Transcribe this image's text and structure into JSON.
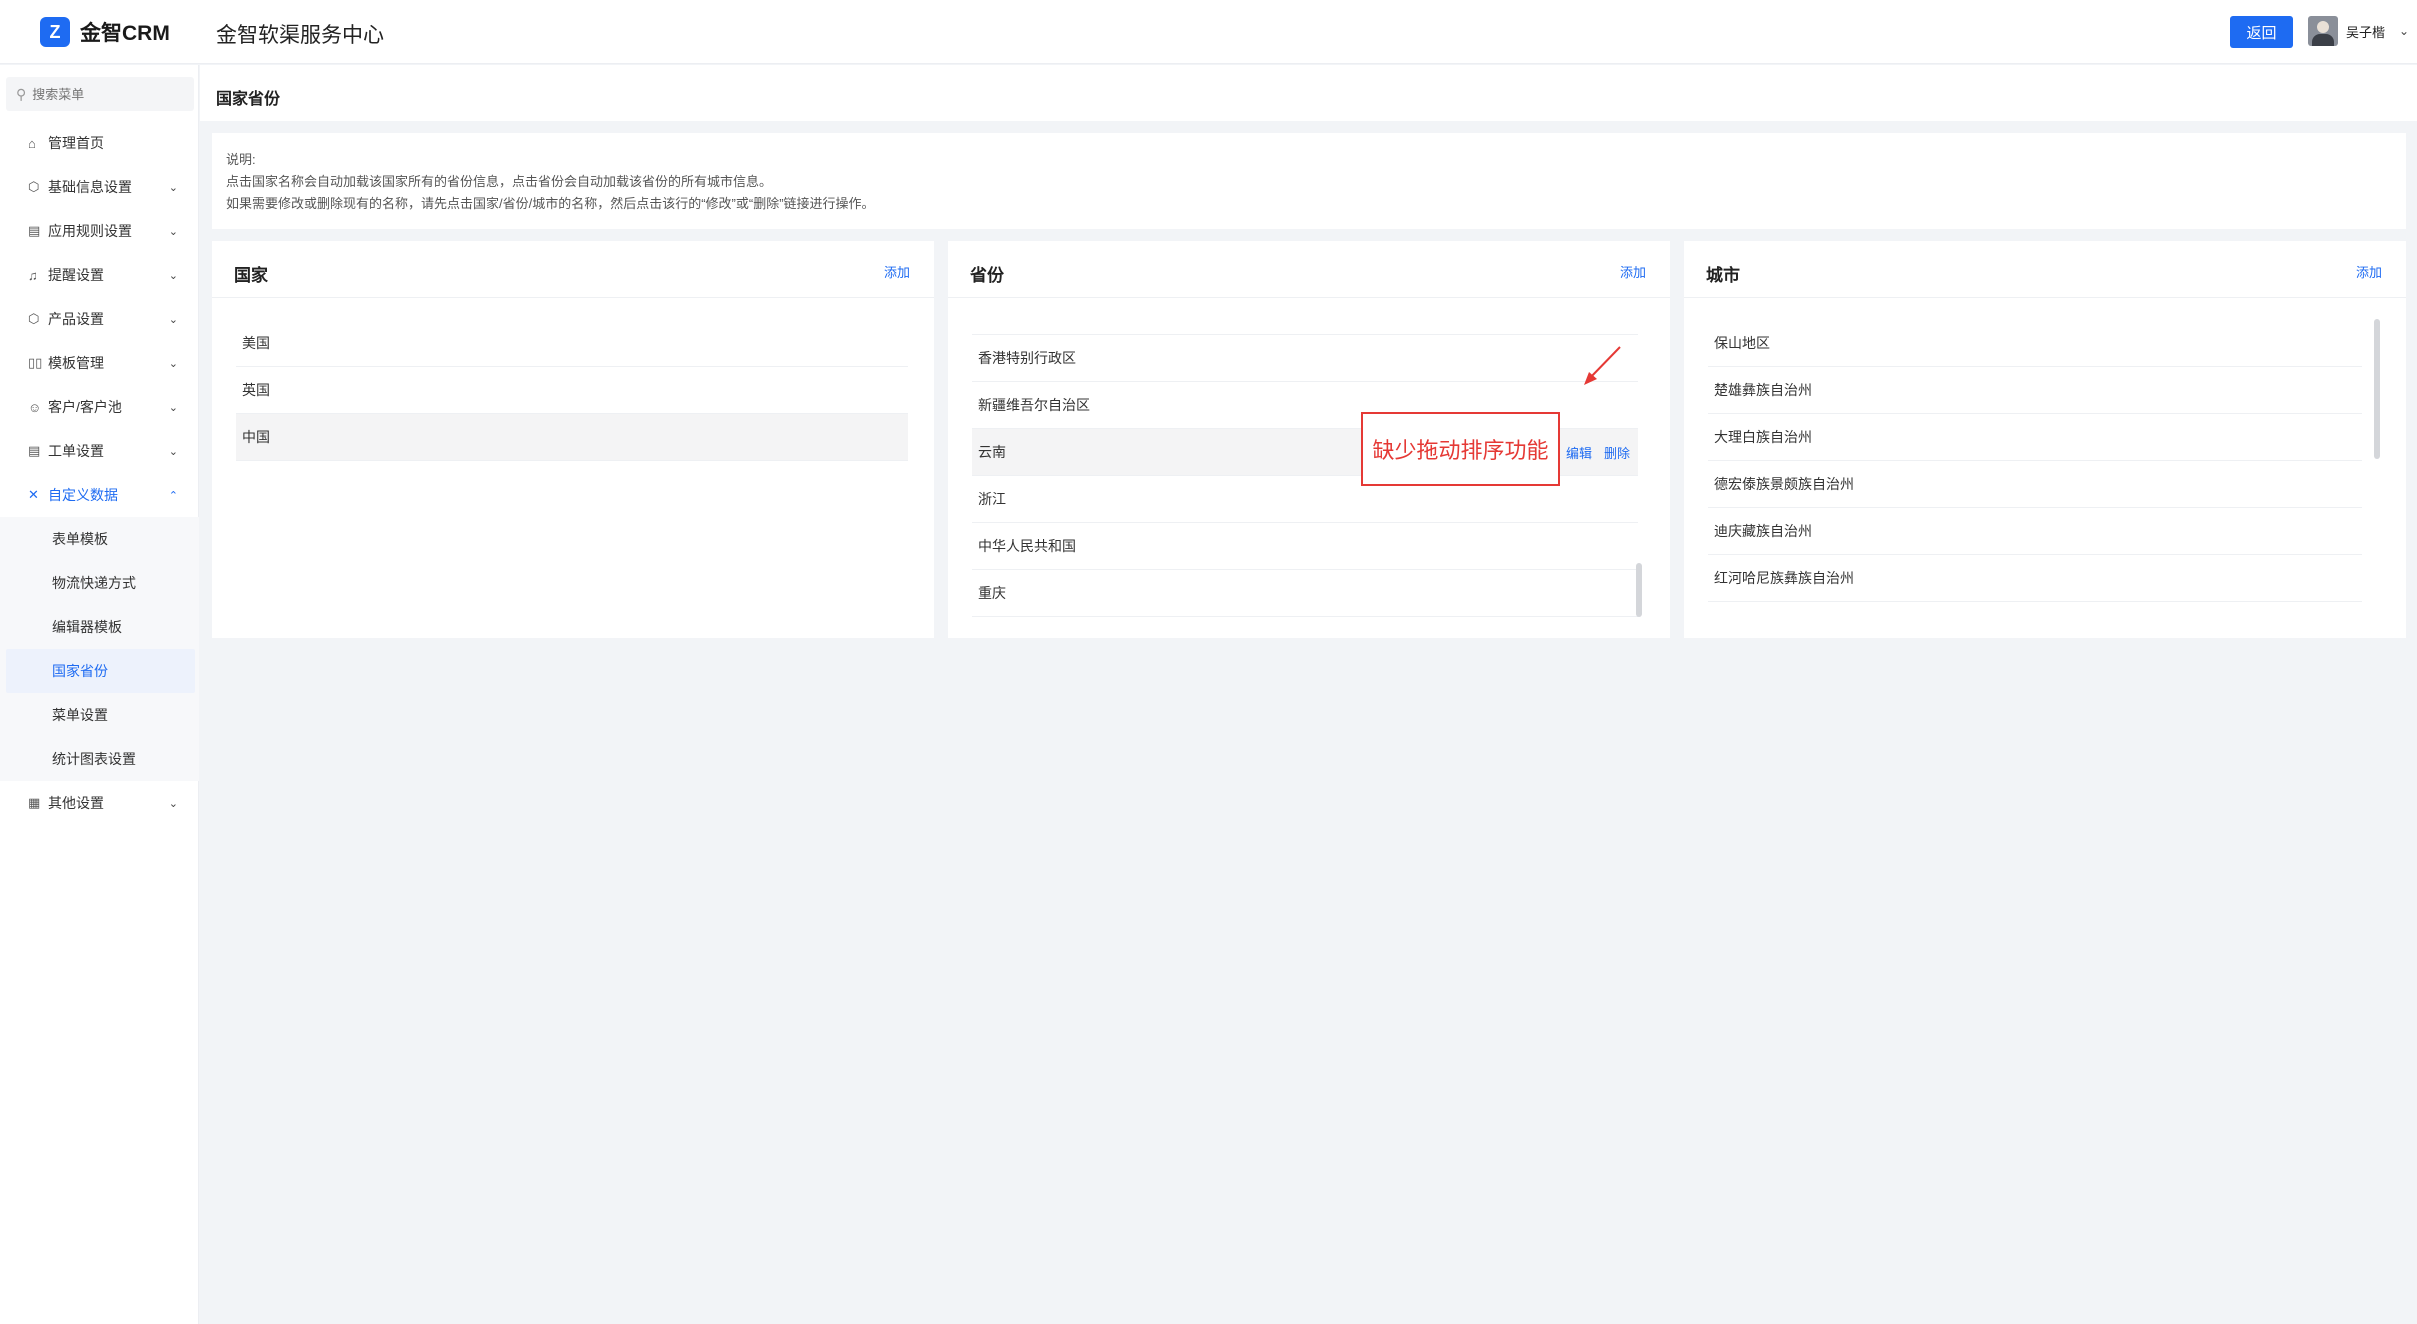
{
  "header": {
    "logo_mark": "Z",
    "logo_text": "金智CRM",
    "site_title": "金智软渠服务中心",
    "back_label": "返回",
    "user_name": "吴子楷"
  },
  "sidebar": {
    "search_placeholder": "搜索菜单",
    "items": [
      {
        "label": "管理首页",
        "icon": "home-icon",
        "glyph": "⌂",
        "caret": ""
      },
      {
        "label": "基础信息设置",
        "icon": "cube-icon",
        "glyph": "⬡",
        "caret": "⌄"
      },
      {
        "label": "应用规则设置",
        "icon": "document-icon",
        "glyph": "▤",
        "caret": "⌄"
      },
      {
        "label": "提醒设置",
        "icon": "bell-icon",
        "glyph": "♫",
        "caret": "⌄"
      },
      {
        "label": "产品设置",
        "icon": "box-icon",
        "glyph": "⬡",
        "caret": "⌄"
      },
      {
        "label": "模板管理",
        "icon": "template-icon",
        "glyph": "▯▯",
        "caret": "⌄"
      },
      {
        "label": "客户/客户池",
        "icon": "users-icon",
        "glyph": "☺",
        "caret": "⌄"
      },
      {
        "label": "工单设置",
        "icon": "ticket-icon",
        "glyph": "▤",
        "caret": "⌄"
      },
      {
        "label": "自定义数据",
        "icon": "tools-icon",
        "glyph": "✕",
        "caret": "⌃"
      }
    ],
    "sub_items": [
      "表单模板",
      "物流快递方式",
      "编辑器模板",
      "国家省份",
      "菜单设置",
      "统计图表设置"
    ],
    "last_item": {
      "label": "其他设置",
      "icon": "grid-icon",
      "glyph": "▦",
      "caret": "⌄"
    }
  },
  "page": {
    "title": "国家省份",
    "notice": [
      "说明:",
      "点击国家名称会自动加载该国家所有的省份信息，点击省份会自动加载该省份的所有城市信息。",
      "如果需要修改或删除现有的名称，请先点击国家/省份/城市的名称，然后点击该行的“修改”或“删除”链接进行操作。"
    ]
  },
  "panels": {
    "country": {
      "title": "国家",
      "add": "添加",
      "rows": [
        "美国",
        "英国",
        "中国"
      ]
    },
    "province": {
      "title": "省份",
      "add": "添加",
      "rows": [
        "香港特别行政区",
        "新疆维吾尔自治区",
        "云南",
        "浙江",
        "中华人民共和国",
        "重庆"
      ],
      "edit": "编辑",
      "delete": "删除"
    },
    "city": {
      "title": "城市",
      "add": "添加",
      "rows": [
        "保山地区",
        "楚雄彝族自治州",
        "大理白族自治州",
        "德宏傣族景颇族自治州",
        "迪庆藏族自治州",
        "红河哈尼族彝族自治州"
      ]
    }
  },
  "annotation": {
    "text": "缺少拖动排序功能",
    "color": "#e53935"
  },
  "colors": {
    "accent": "#1e6bf2",
    "background": "#f2f4f7"
  }
}
